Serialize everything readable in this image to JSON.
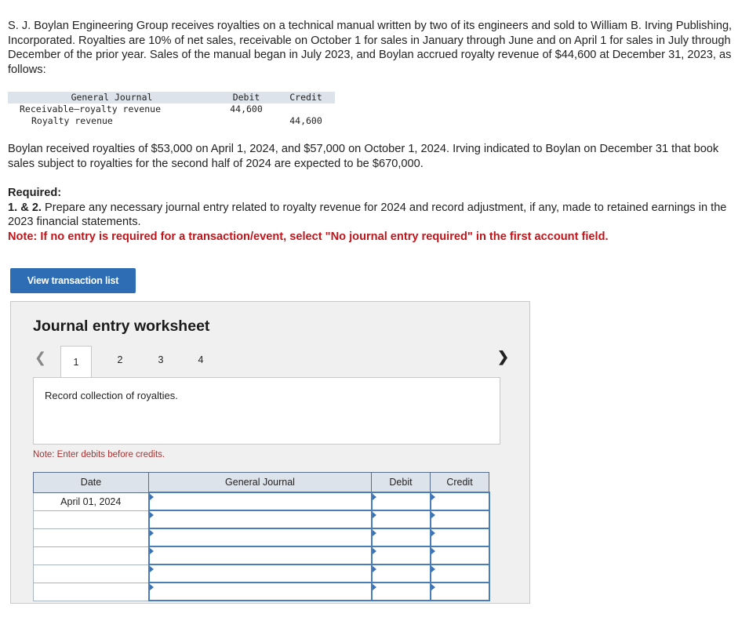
{
  "intro": "S. J. Boylan Engineering Group receives royalties on a technical manual written by two of its engineers and sold to William B. Irving Publishing, Incorporated. Royalties are 10% of net sales, receivable on October 1 for sales in January through June and on April 1 for sales in July through December of the prior year. Sales of the manual began in July 2023, and Boylan accrued royalty revenue of $44,600 at December 31, 2023, as follows:",
  "journal": {
    "header": {
      "account": "General Journal",
      "debit": "Debit",
      "credit": "Credit"
    },
    "rows": [
      {
        "account": "Receivable—royalty revenue",
        "debit": "44,600",
        "credit": ""
      },
      {
        "account": "   Royalty revenue",
        "debit": "",
        "credit": "44,600"
      }
    ]
  },
  "para2": "Boylan received royalties of $53,000 on April 1, 2024, and $57,000 on October 1, 2024. Irving indicated to Boylan on December 31 that book sales subject to royalties for the second half of 2024 are expected to be $670,000.",
  "required": {
    "heading": "Required:",
    "label": "1. & 2.",
    "text": " Prepare any necessary journal entry related to royalty revenue for 2024 and record adjustment, if any, made to retained earnings in the 2023 financial statements.",
    "note": "Note: If no entry is required for a transaction/event, select \"No journal entry required\" in the first account field."
  },
  "view_button": "View transaction list",
  "worksheet": {
    "title": "Journal entry worksheet",
    "tabs": [
      "1",
      "2",
      "3",
      "4"
    ],
    "active_tab": "1",
    "description": "Record collection of royalties.",
    "note": "Note: Enter debits before credits.",
    "columns": {
      "date": "Date",
      "journal": "General Journal",
      "debit": "Debit",
      "credit": "Credit"
    },
    "rows": [
      {
        "date": "April 01, 2024"
      },
      {
        "date": ""
      },
      {
        "date": ""
      },
      {
        "date": ""
      },
      {
        "date": ""
      },
      {
        "date": ""
      }
    ]
  },
  "colors": {
    "accent": "#2e6db4",
    "note_red": "#c0151b",
    "header_bg": "#dde3ea"
  }
}
